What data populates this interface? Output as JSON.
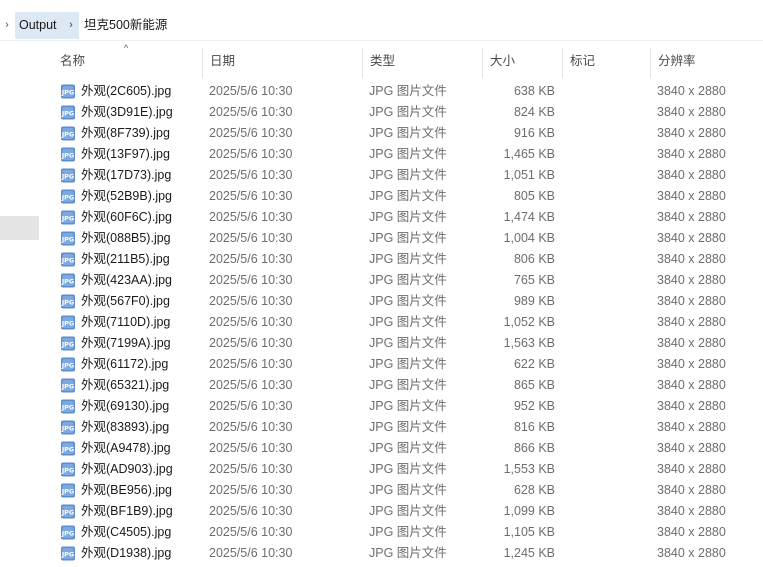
{
  "breadcrumb": {
    "left_arrow": "›",
    "parent": "Output",
    "separator": "›",
    "current": "坦克500新能源"
  },
  "columns": {
    "name": "名称",
    "date": "日期",
    "type": "类型",
    "size": "大小",
    "tag": "标记",
    "resolution": "分辨率"
  },
  "icons": {
    "file": "jpg-file-icon",
    "sort": "sort-ascending-icon"
  },
  "files": [
    {
      "name": "外观(2C605).jpg",
      "date": "2025/5/6 10:30",
      "type": "JPG 图片文件",
      "size": "638 KB",
      "resolution": "3840 x 2880"
    },
    {
      "name": "外观(3D91E).jpg",
      "date": "2025/5/6 10:30",
      "type": "JPG 图片文件",
      "size": "824 KB",
      "resolution": "3840 x 2880"
    },
    {
      "name": "外观(8F739).jpg",
      "date": "2025/5/6 10:30",
      "type": "JPG 图片文件",
      "size": "916 KB",
      "resolution": "3840 x 2880"
    },
    {
      "name": "外观(13F97).jpg",
      "date": "2025/5/6 10:30",
      "type": "JPG 图片文件",
      "size": "1,465 KB",
      "resolution": "3840 x 2880"
    },
    {
      "name": "外观(17D73).jpg",
      "date": "2025/5/6 10:30",
      "type": "JPG 图片文件",
      "size": "1,051 KB",
      "resolution": "3840 x 2880"
    },
    {
      "name": "外观(52B9B).jpg",
      "date": "2025/5/6 10:30",
      "type": "JPG 图片文件",
      "size": "805 KB",
      "resolution": "3840 x 2880"
    },
    {
      "name": "外观(60F6C).jpg",
      "date": "2025/5/6 10:30",
      "type": "JPG 图片文件",
      "size": "1,474 KB",
      "resolution": "3840 x 2880"
    },
    {
      "name": "外观(088B5).jpg",
      "date": "2025/5/6 10:30",
      "type": "JPG 图片文件",
      "size": "1,004 KB",
      "resolution": "3840 x 2880"
    },
    {
      "name": "外观(211B5).jpg",
      "date": "2025/5/6 10:30",
      "type": "JPG 图片文件",
      "size": "806 KB",
      "resolution": "3840 x 2880"
    },
    {
      "name": "外观(423AA).jpg",
      "date": "2025/5/6 10:30",
      "type": "JPG 图片文件",
      "size": "765 KB",
      "resolution": "3840 x 2880"
    },
    {
      "name": "外观(567F0).jpg",
      "date": "2025/5/6 10:30",
      "type": "JPG 图片文件",
      "size": "989 KB",
      "resolution": "3840 x 2880"
    },
    {
      "name": "外观(7110D).jpg",
      "date": "2025/5/6 10:30",
      "type": "JPG 图片文件",
      "size": "1,052 KB",
      "resolution": "3840 x 2880"
    },
    {
      "name": "外观(7199A).jpg",
      "date": "2025/5/6 10:30",
      "type": "JPG 图片文件",
      "size": "1,563 KB",
      "resolution": "3840 x 2880"
    },
    {
      "name": "外观(61172).jpg",
      "date": "2025/5/6 10:30",
      "type": "JPG 图片文件",
      "size": "622 KB",
      "resolution": "3840 x 2880"
    },
    {
      "name": "外观(65321).jpg",
      "date": "2025/5/6 10:30",
      "type": "JPG 图片文件",
      "size": "865 KB",
      "resolution": "3840 x 2880"
    },
    {
      "name": "外观(69130).jpg",
      "date": "2025/5/6 10:30",
      "type": "JPG 图片文件",
      "size": "952 KB",
      "resolution": "3840 x 2880"
    },
    {
      "name": "外观(83893).jpg",
      "date": "2025/5/6 10:30",
      "type": "JPG 图片文件",
      "size": "816 KB",
      "resolution": "3840 x 2880"
    },
    {
      "name": "外观(A9478).jpg",
      "date": "2025/5/6 10:30",
      "type": "JPG 图片文件",
      "size": "866 KB",
      "resolution": "3840 x 2880"
    },
    {
      "name": "外观(AD903).jpg",
      "date": "2025/5/6 10:30",
      "type": "JPG 图片文件",
      "size": "1,553 KB",
      "resolution": "3840 x 2880"
    },
    {
      "name": "外观(BE956).jpg",
      "date": "2025/5/6 10:30",
      "type": "JPG 图片文件",
      "size": "628 KB",
      "resolution": "3840 x 2880"
    },
    {
      "name": "外观(BF1B9).jpg",
      "date": "2025/5/6 10:30",
      "type": "JPG 图片文件",
      "size": "1,099 KB",
      "resolution": "3840 x 2880"
    },
    {
      "name": "外观(C4505).jpg",
      "date": "2025/5/6 10:30",
      "type": "JPG 图片文件",
      "size": "1,105 KB",
      "resolution": "3840 x 2880"
    },
    {
      "name": "外观(D1938).jpg",
      "date": "2025/5/6 10:30",
      "type": "JPG 图片文件",
      "size": "1,245 KB",
      "resolution": "3840 x 2880"
    }
  ]
}
